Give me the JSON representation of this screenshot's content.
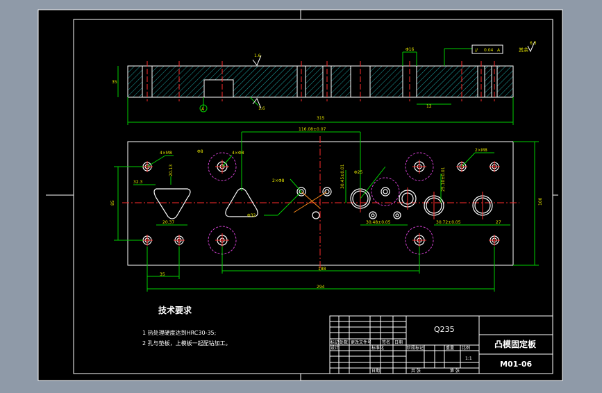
{
  "drawing": {
    "part_name": "凸模固定板",
    "drawing_number": "M01-06",
    "material": "Q235",
    "scale": "1:1",
    "tech_title": "技术要求",
    "tech_notes": [
      "1 热处理硬度达到HRC30-35;",
      "2 孔与垫板，上模板一起配钻加工。"
    ],
    "corner_roughness": "6.3",
    "corner_note": "其余"
  },
  "dimensions": {
    "overall_length": "315",
    "height_side": "35",
    "dia_top": "Φ16",
    "tolerance_box": "0.04",
    "rough_top": "1.6",
    "rough_bottom": "1.6",
    "datum": "A",
    "depth_small": "12",
    "dim_top_center": "116.08±0.07",
    "dim_4x_m8": "4×M8",
    "dim_4x_phi": "4×Φ8",
    "dim_phi_left": "Φ8",
    "dim_left_small": "32.3",
    "dim_left_vert": "20.13",
    "dim_left_vert2": "8",
    "dim_width_left": "20.37",
    "dim_width_right": "30.48±0.05",
    "dim_width_right2": "30.72±0.05",
    "dim_right_27": "27",
    "dim_height_plan": "100",
    "dim_left_85": "85",
    "dim_bottom_35": "35",
    "dim_bottom_188": "188",
    "dim_bottom_294": "294",
    "dim_center_4x": "2×Φ8",
    "dim_center_phi": "Φ32",
    "dim_center_vert": "30.45±0.01",
    "dim_right_vert": "25.10±0.01",
    "dim_phi_mid": "Φ25",
    "dim_2xm8": "2×M8"
  },
  "title_block": {
    "row1": [
      "标记",
      "处数",
      "更改文件号",
      "签名",
      "日期"
    ],
    "row2": [
      "设计",
      "",
      "",
      "标准化",
      ""
    ],
    "row3": [
      "审核",
      "",
      "",
      "",
      ""
    ],
    "row4": [
      "工艺",
      "",
      "日期",
      "",
      ""
    ],
    "right_headers": [
      "阶段标记",
      "重量",
      "比例"
    ],
    "sheet": [
      "共 张",
      "第 张"
    ]
  }
}
